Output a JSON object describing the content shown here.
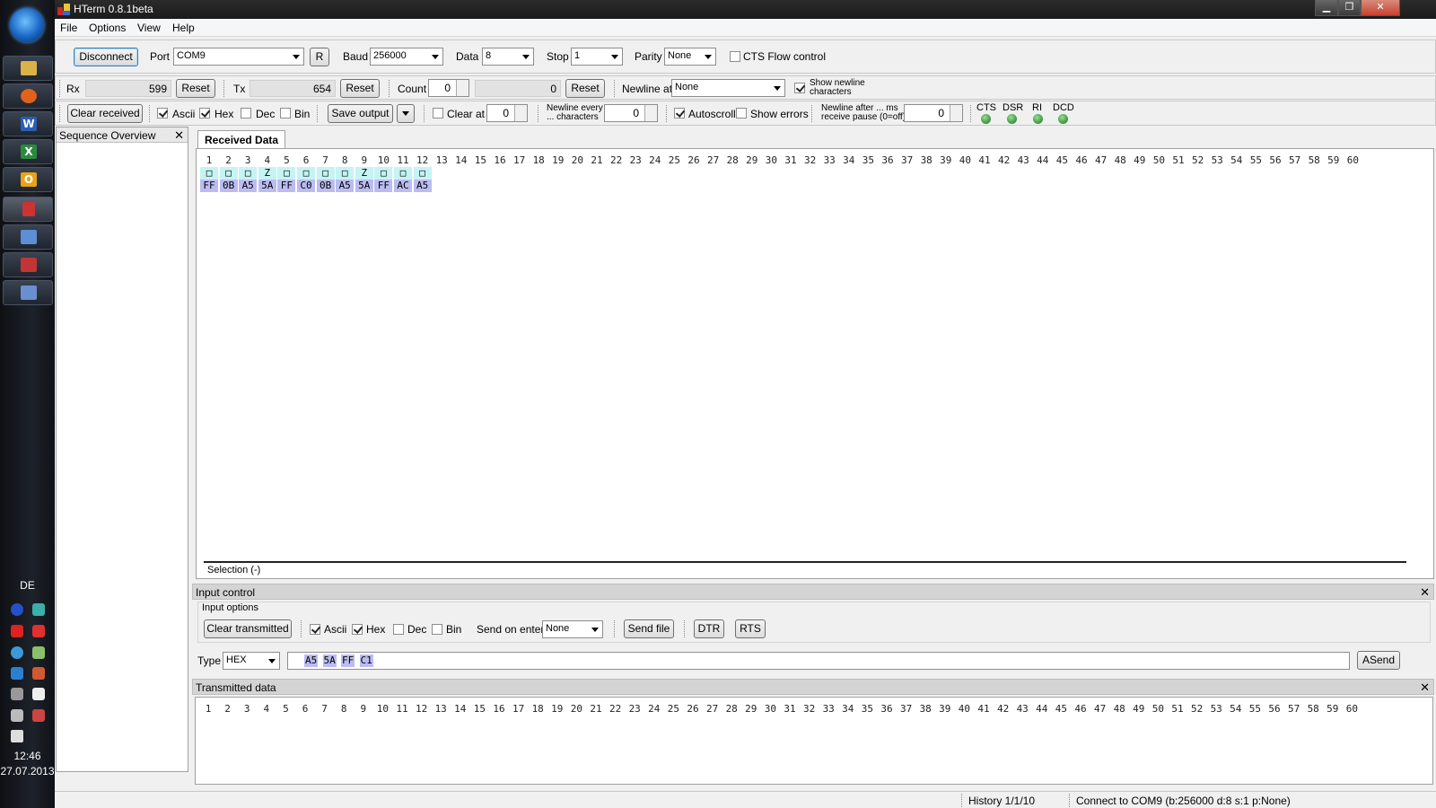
{
  "window": {
    "title": "HTerm 0.8.1beta"
  },
  "menu": {
    "file": "File",
    "options": "Options",
    "view": "View",
    "help": "Help"
  },
  "connection": {
    "disconnect_label": "Disconnect",
    "port_label": "Port",
    "port_value": "COM9",
    "refresh_label": "R",
    "baud_label": "Baud",
    "baud_value": "256000",
    "data_label": "Data",
    "data_value": "8",
    "stop_label": "Stop",
    "stop_value": "1",
    "parity_label": "Parity",
    "parity_value": "None",
    "cts_label": "CTS Flow control",
    "cts_checked": false
  },
  "counters": {
    "rx_label": "Rx",
    "rx_value": "599",
    "rx_reset": "Reset",
    "tx_label": "Tx",
    "tx_value": "654",
    "tx_reset": "Reset",
    "count_label": "Count",
    "count_value": "0",
    "count_total": "0",
    "count_reset": "Reset",
    "newline_at_label": "Newline at",
    "newline_at_value": "None",
    "show_newline_label_1": "Show newline",
    "show_newline_label_2": "characters"
  },
  "display_bar": {
    "clear_received": "Clear received",
    "ascii": "Ascii",
    "hex": "Hex",
    "dec": "Dec",
    "bin": "Bin",
    "save_output": "Save output",
    "clear_at": "Clear at",
    "clear_at_value": "0",
    "newline_every_1": "Newline every",
    "newline_every_2": "... characters",
    "newline_every_value": "0",
    "autoscroll": "Autoscroll",
    "show_errors": "Show errors",
    "newline_after_1": "Newline after ... ms",
    "newline_after_2": "receive pause (0=off)",
    "newline_after_value": "0",
    "leds": [
      "CTS",
      "DSR",
      "RI",
      "DCD"
    ]
  },
  "sequence_overview": {
    "title": "Sequence Overview",
    "close": "✕"
  },
  "received": {
    "tab": "Received Data",
    "columns": [
      "1",
      "2",
      "3",
      "4",
      "5",
      "6",
      "7",
      "8",
      "9",
      "10",
      "11",
      "12",
      "13",
      "14",
      "15",
      "16",
      "17",
      "18",
      "19",
      "20",
      "21",
      "22",
      "23",
      "24",
      "25",
      "26",
      "27",
      "28",
      "29",
      "30",
      "31",
      "32",
      "33",
      "34",
      "35",
      "36",
      "37",
      "38",
      "39",
      "40",
      "41",
      "42",
      "43",
      "44",
      "45",
      "46",
      "47",
      "48",
      "49",
      "50",
      "51",
      "52",
      "53",
      "54",
      "55",
      "56",
      "57",
      "58",
      "59",
      "60"
    ],
    "ascii": [
      "□",
      "□",
      "□",
      "Z",
      "□",
      "□",
      "□",
      "□",
      "Z",
      "□",
      "□",
      "□"
    ],
    "hex": [
      "FF",
      "0B",
      "A5",
      "5A",
      "FF",
      "C0",
      "0B",
      "A5",
      "5A",
      "FF",
      "AC",
      "A5"
    ],
    "selection": "Selection (-)"
  },
  "input_control": {
    "title": "Input control",
    "close": "✕",
    "options_title": "Input options",
    "clear_transmitted": "Clear transmitted",
    "ascii": "Ascii",
    "hex": "Hex",
    "dec": "Dec",
    "bin": "Bin",
    "send_on_enter_label": "Send on enter",
    "send_on_enter_value": "None",
    "send_file": "Send file",
    "dtr": "DTR",
    "rts": "RTS",
    "type_label": "Type",
    "type_value": "HEX",
    "input_bytes": [
      "A5",
      "5A",
      "FF",
      "C1"
    ],
    "asend": "ASend"
  },
  "transmitted": {
    "title": "Transmitted data",
    "close": "✕",
    "columns": [
      "1",
      "2",
      "3",
      "4",
      "5",
      "6",
      "7",
      "8",
      "9",
      "10",
      "11",
      "12",
      "13",
      "14",
      "15",
      "16",
      "17",
      "18",
      "19",
      "20",
      "21",
      "22",
      "23",
      "24",
      "25",
      "26",
      "27",
      "28",
      "29",
      "30",
      "31",
      "32",
      "33",
      "34",
      "35",
      "36",
      "37",
      "38",
      "39",
      "40",
      "41",
      "42",
      "43",
      "44",
      "45",
      "46",
      "47",
      "48",
      "49",
      "50",
      "51",
      "52",
      "53",
      "54",
      "55",
      "56",
      "57",
      "58",
      "59",
      "60"
    ]
  },
  "status": {
    "history": "History 1/1/10",
    "connection": "Connect to COM9 (b:256000 d:8 s:1 p:None)"
  },
  "taskbar": {
    "lang": "DE",
    "time": "12:46",
    "date": "27.07.2013"
  }
}
